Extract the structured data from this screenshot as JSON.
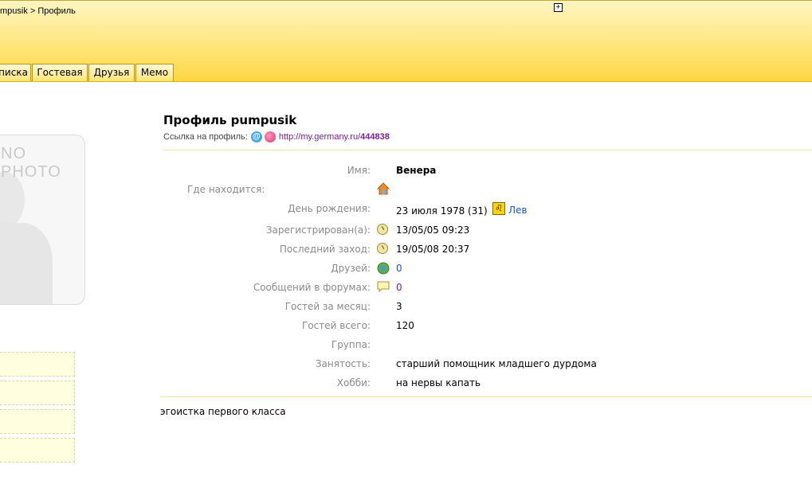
{
  "header": {
    "breadcrumb": "mpusik > Профиль",
    "expand_icon": "plus-box-icon",
    "tabs": [
      "писка",
      "Гостевая",
      "Друзья",
      "Мемо"
    ]
  },
  "photo": {
    "placeholder": "NO PHOTO"
  },
  "profile": {
    "title": "Профиль pumpusik",
    "link_label": "Ссылка на профиль:",
    "url_prefix": "http://my.germany.ru/",
    "url_id": "444838",
    "fields": [
      {
        "label": "Имя:",
        "value": "Венера"
      },
      {
        "label": "Где находится:",
        "value": ""
      },
      {
        "label": "День рождения:",
        "value": "23 июля 1978 (31)"
      },
      {
        "label": "Зарегистрирован(а):",
        "value": "13/05/05 09:23"
      },
      {
        "label": "Последний заход:",
        "value": "19/05/08 20:37"
      },
      {
        "label": "Друзей:",
        "value": "0"
      },
      {
        "label": "Сообщений в форумах:",
        "value": "0"
      },
      {
        "label": "Гостей за месяц:",
        "value": "3"
      },
      {
        "label": "Гостей всего:",
        "value": "120"
      },
      {
        "label": "Группа:",
        "value": ""
      },
      {
        "label": "Занятость:",
        "value": "старший помощник младшего дурдома"
      },
      {
        "label": "Хобби:",
        "value": "на нервы капать"
      }
    ],
    "zodiac": "Лев",
    "about": "эгоистка первого класса"
  },
  "icons": {
    "home": "house-icon",
    "clock": "clock-icon",
    "friends": "globe-people-icon",
    "forum": "speech-bubble-icon",
    "zodiac": "leo-zodiac-icon"
  }
}
